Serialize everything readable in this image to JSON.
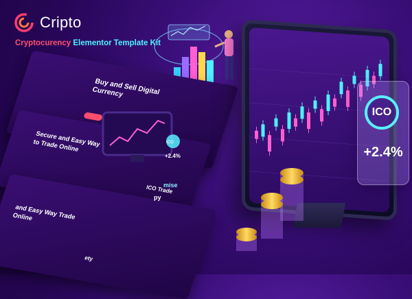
{
  "brand": {
    "name": "Cripto",
    "tagline_part1": "Cryptocurency",
    "tagline_part2": "Elementor Template Kit"
  },
  "mock_pages": {
    "hero_title": "Buy and Sell Digital Currency",
    "secure_title": "Secure and Easy Way to Trade Online",
    "ico_title": "ICO Trade",
    "promise": "mise",
    "easy_way": "and Easy Way Trade Online",
    "partial_1": "py",
    "partial_2": "ety",
    "ico_small": "ICO",
    "ico_small_pct": "+2.4%"
  },
  "ico_card": {
    "label": "ICO",
    "change": "+2.4%"
  },
  "colors": {
    "accent_pink": "#ff4f6e",
    "accent_cyan": "#4ff0ff",
    "background": "#3b0f7a",
    "coin_gold": "#f5c542"
  },
  "icons": [
    "logo-icon",
    "candlestick-chart-icon",
    "bar-chart-icon",
    "coin-icon",
    "person-illustration-icon"
  ]
}
